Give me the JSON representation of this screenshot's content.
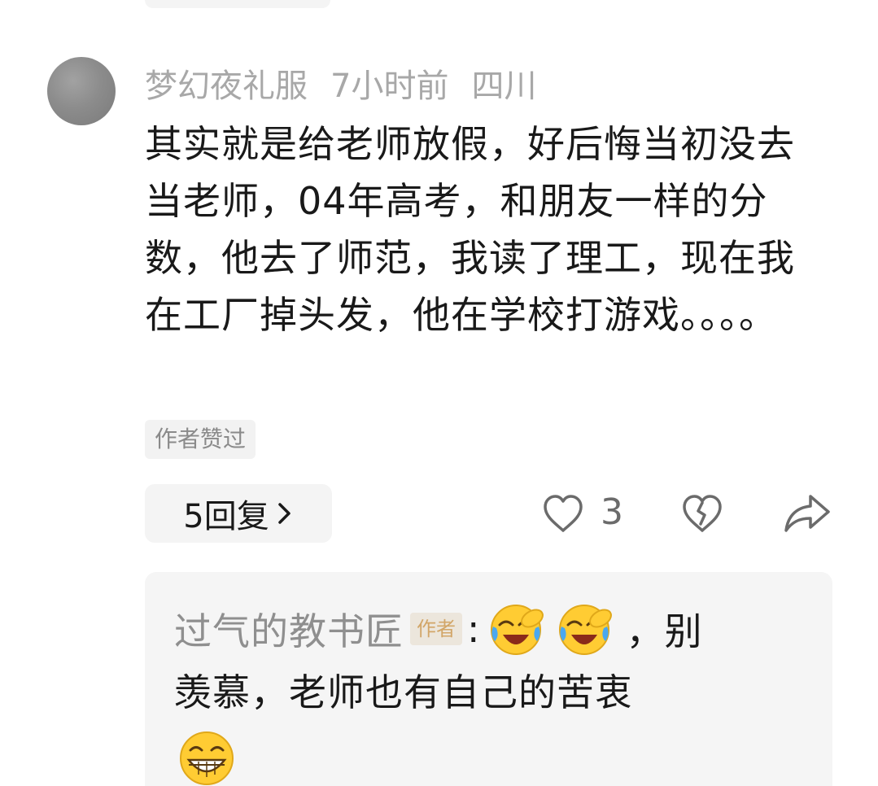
{
  "comment": {
    "username": "梦幻夜礼服",
    "time": "7小时前",
    "location": "四川",
    "text": "其实就是给老师放假，好后悔当初没去当老师，04年高考，和朋友一样的分数，他去了师范，我读了理工，现在我在工厂掉头发，他在学校打游戏。。。。",
    "author_liked_label": "作者赞过",
    "reply_button_label": "5回复",
    "like_count": "3",
    "icons": {
      "like": "heart-outline-icon",
      "dislike": "broken-heart-icon",
      "share": "share-arrow-icon",
      "reply_chevron": "chevron-right-icon"
    }
  },
  "reply": {
    "username": "过气的教书匠",
    "author_tag": "作者",
    "colon": ":",
    "text_line1": "，别",
    "text_line2": "羡慕，老师也有自己的苦衷",
    "emojis": [
      "face-with-tears-of-joy-emoji",
      "face-with-tears-of-joy-emoji",
      "grinning-face-emoji"
    ]
  },
  "colors": {
    "meta_gray": "#a8a8a8",
    "text_dark": "#191919",
    "author_tag_text": "#d2a668",
    "author_tag_bg": "#ece6dc",
    "panel_bg": "#f5f5f5"
  }
}
